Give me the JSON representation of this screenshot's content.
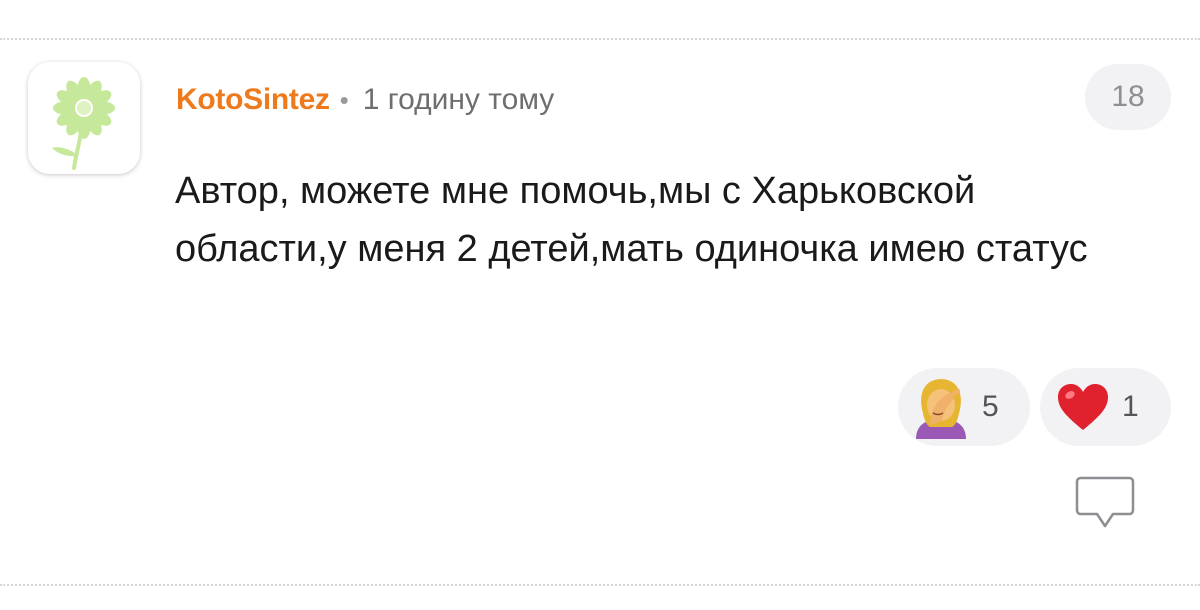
{
  "comment": {
    "author": "KotoSintez",
    "separator": "•",
    "time": "1 годину тому",
    "score": "18",
    "text": "Автор, можете мне помочь,мы с Харьковской области,у меня 2 детей,мать одиночка имею статус",
    "avatar_icon": "flower-icon"
  },
  "reactions": [
    {
      "icon": "facepalm-emoji-icon",
      "count": "5"
    },
    {
      "icon": "heart-emoji-icon",
      "count": "1"
    }
  ],
  "actions": {
    "reply_icon": "speech-bubble-icon"
  },
  "colors": {
    "author": "#ee7a1c",
    "pill_background": "#f2f2f4",
    "flower": "#c6e89a"
  }
}
